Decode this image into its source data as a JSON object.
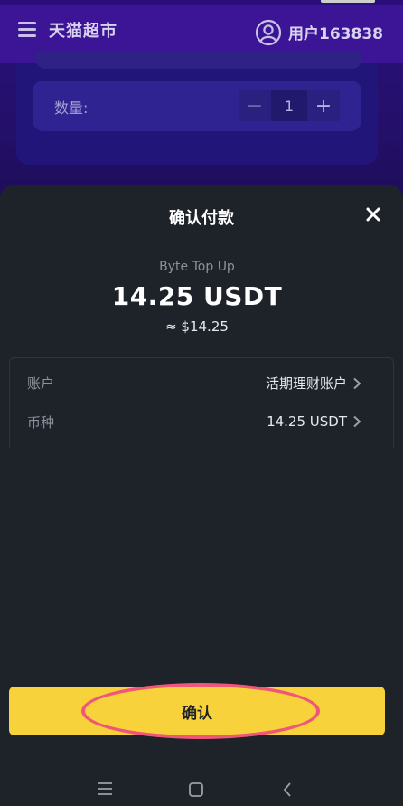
{
  "header": {
    "app_title": "天猫超市",
    "user_label": "用户163838"
  },
  "quantity": {
    "label": "数量:",
    "minus_symbol": "−",
    "value": "1",
    "plus_symbol": "+"
  },
  "modal": {
    "title": "确认付款",
    "merchant": "Byte Top Up",
    "amount": "14.25 USDT",
    "approx_value": "≈ $14.25",
    "rows": [
      {
        "label": "账户",
        "value": "活期理财账户"
      },
      {
        "label": "币种",
        "value": "14.25 USDT"
      }
    ],
    "confirm_label": "确认"
  },
  "colors": {
    "header_bg": "#3b1595",
    "sheet_bg": "#1e2229",
    "confirm_yellow": "#f7d23a",
    "highlight_ring": "#f0567a"
  },
  "icons": {
    "menu": "hamburger-menu-icon",
    "user": "user-circle-icon",
    "close": "close-icon",
    "chevron": "chevron-right-icon",
    "nav_menu": "nav-menu-icon",
    "nav_home": "nav-home-icon",
    "nav_back": "nav-back-icon"
  }
}
